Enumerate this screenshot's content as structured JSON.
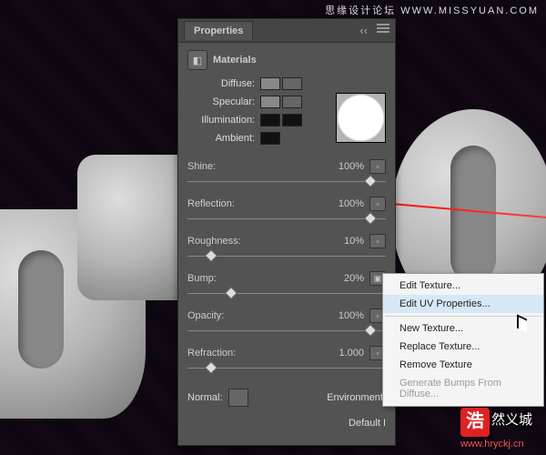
{
  "topWatermark": "思缘设计论坛  WWW.MISSYUAN.COM",
  "panel": {
    "title": "Properties",
    "section": "Materials",
    "color_rows": [
      {
        "label": "Diffuse:"
      },
      {
        "label": "Specular:"
      },
      {
        "label": "Illumination:"
      },
      {
        "label": "Ambient:"
      }
    ],
    "sliders": {
      "shine": {
        "label": "Shine:",
        "value": "100%",
        "pos": 92
      },
      "reflection": {
        "label": "Reflection:",
        "value": "100%",
        "pos": 92
      },
      "roughness": {
        "label": "Roughness:",
        "value": "10%",
        "pos": 12
      },
      "bump": {
        "label": "Bump:",
        "value": "20%",
        "pos": 22
      },
      "opacity": {
        "label": "Opacity:",
        "value": "100%",
        "pos": 92
      },
      "refraction": {
        "label": "Refraction:",
        "value": "1.000",
        "pos": 12
      }
    },
    "bottom": {
      "normal": "Normal:",
      "env": "Environment:",
      "default": "Default I"
    }
  },
  "menu": {
    "edit_tex": "Edit Texture...",
    "edit_uv": "Edit UV Properties...",
    "new_tex": "New Texture...",
    "replace_tex": "Replace Texture...",
    "remove_tex": "Remove Texture",
    "gen_bumps": "Generate Bumps From Diffuse..."
  },
  "logo": {
    "char": "浩",
    "text": "然义城",
    "url": "www.hryckj.cn"
  }
}
